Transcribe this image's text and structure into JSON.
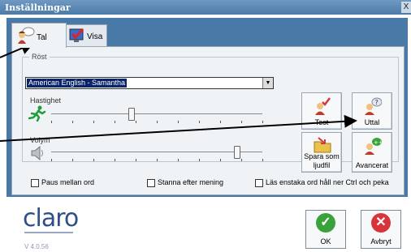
{
  "window": {
    "title": "Inställningar",
    "close_glyph": "X"
  },
  "tabs": [
    {
      "label": "Tal",
      "icon": "speaking-person-icon"
    },
    {
      "label": "Visa",
      "icon": "checkmark-monitor-icon"
    }
  ],
  "group": {
    "legend": "Röst"
  },
  "voice": {
    "selected": "American English - Samantha",
    "arrow": "▼"
  },
  "rate": {
    "label": "Hastighet",
    "level": 0.38
  },
  "volume": {
    "label": "Volym",
    "level": 0.88
  },
  "buttons": {
    "test": "Test",
    "pronunciation": "Uttal",
    "save_audio_line1": "Spara som",
    "save_audio_line2": "ljudfil",
    "advanced": "Avancerat"
  },
  "options": [
    {
      "label": "Paus mellan ord",
      "checked": false
    },
    {
      "label": "Stanna efter mening",
      "checked": false
    },
    {
      "label": "Läs enstaka ord håll ner Ctrl och peka",
      "checked": false
    }
  ],
  "brand": {
    "logo": "claro",
    "version": "V 4.0.56"
  },
  "dialog": {
    "ok_label": "OK",
    "cancel_label": "Avbryt"
  },
  "colors": {
    "titlebar": "#5b87b2",
    "panel": "#497aa7",
    "ok_green": "#3aa23a",
    "cancel_red": "#d8353a"
  }
}
